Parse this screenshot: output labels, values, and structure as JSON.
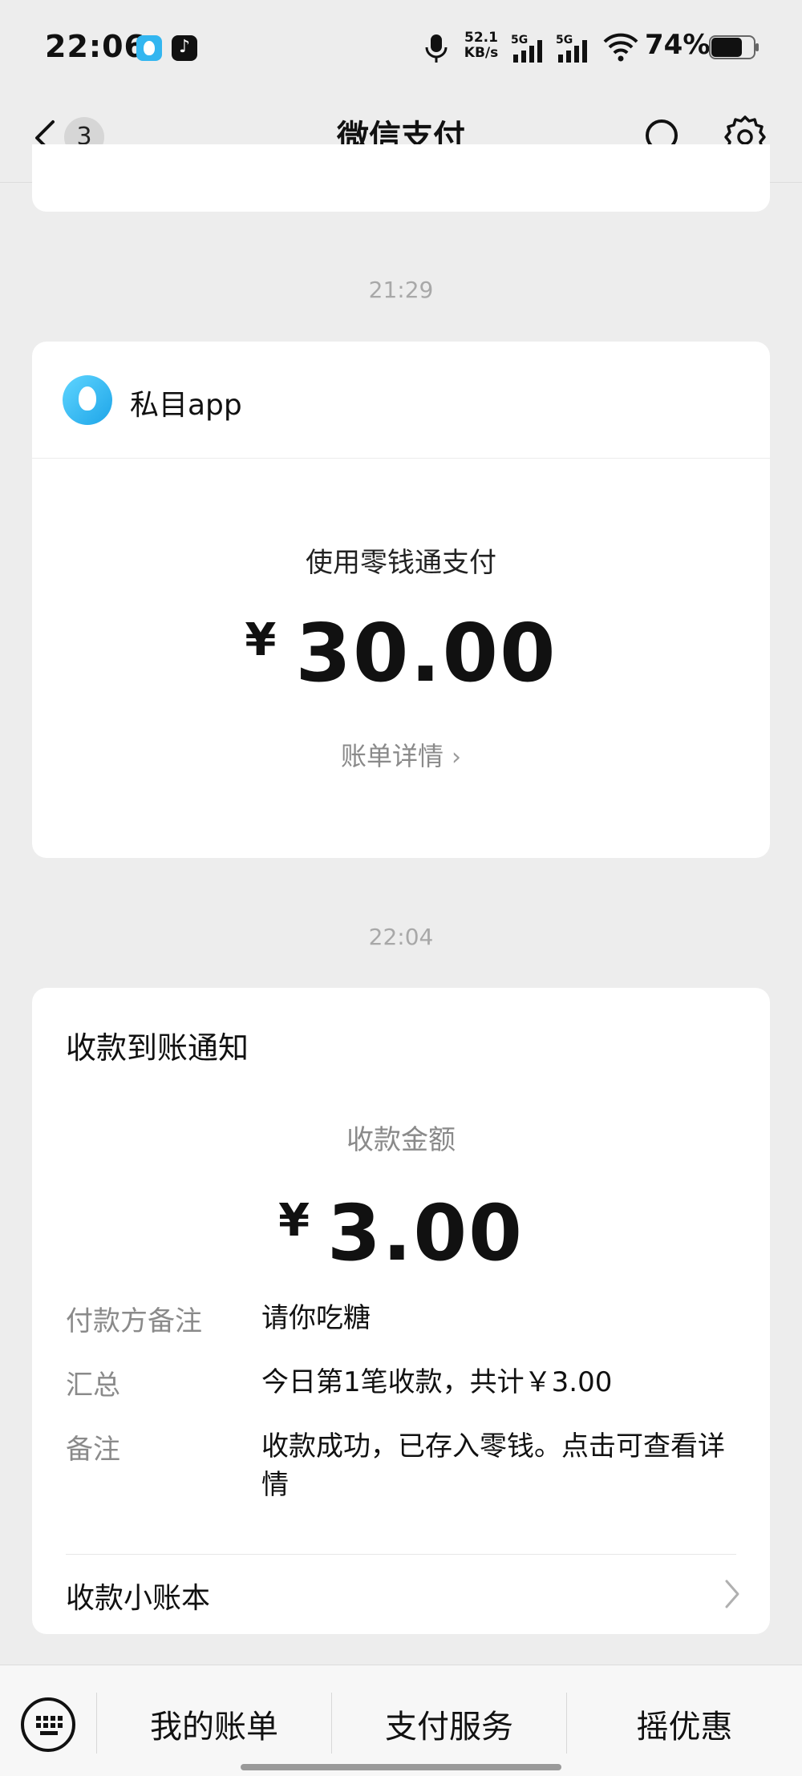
{
  "status_bar": {
    "time": "22:06",
    "tiktok_glyph": "♪",
    "net_speed_value": "52.1",
    "net_speed_unit": "KB/s",
    "signal_1_label": "5G",
    "signal_2_label": "5G",
    "battery": "74%"
  },
  "nav": {
    "unread_count": "3",
    "title": "微信支付"
  },
  "messages": [
    {
      "timestamp": "21:29",
      "merchant_name": "私目app",
      "pay_method": "使用零钱通支付",
      "currency": "¥",
      "amount": "30.00",
      "detail_link": "账单详情",
      "detail_chevron": "›"
    },
    {
      "timestamp": "22:04",
      "title": "收款到账通知",
      "amount_label": "收款金额",
      "currency": "¥",
      "amount": "3.00",
      "rows": [
        {
          "label": "付款方备注",
          "value": "请你吃糖"
        },
        {
          "label": "汇总",
          "value": "今日第1笔收款，共计￥3.00"
        },
        {
          "label": "备注",
          "value": "收款成功，已存入零钱。点击可查看详情"
        }
      ],
      "ledger_link": "收款小账本"
    }
  ],
  "bottom_menu": {
    "items": [
      "我的账单",
      "支付服务",
      "摇优惠"
    ]
  },
  "colors": {
    "background": "#ededed",
    "card": "#ffffff",
    "secondary_text": "#8a8a8a",
    "merchant_logo": "#1ea5e8"
  }
}
